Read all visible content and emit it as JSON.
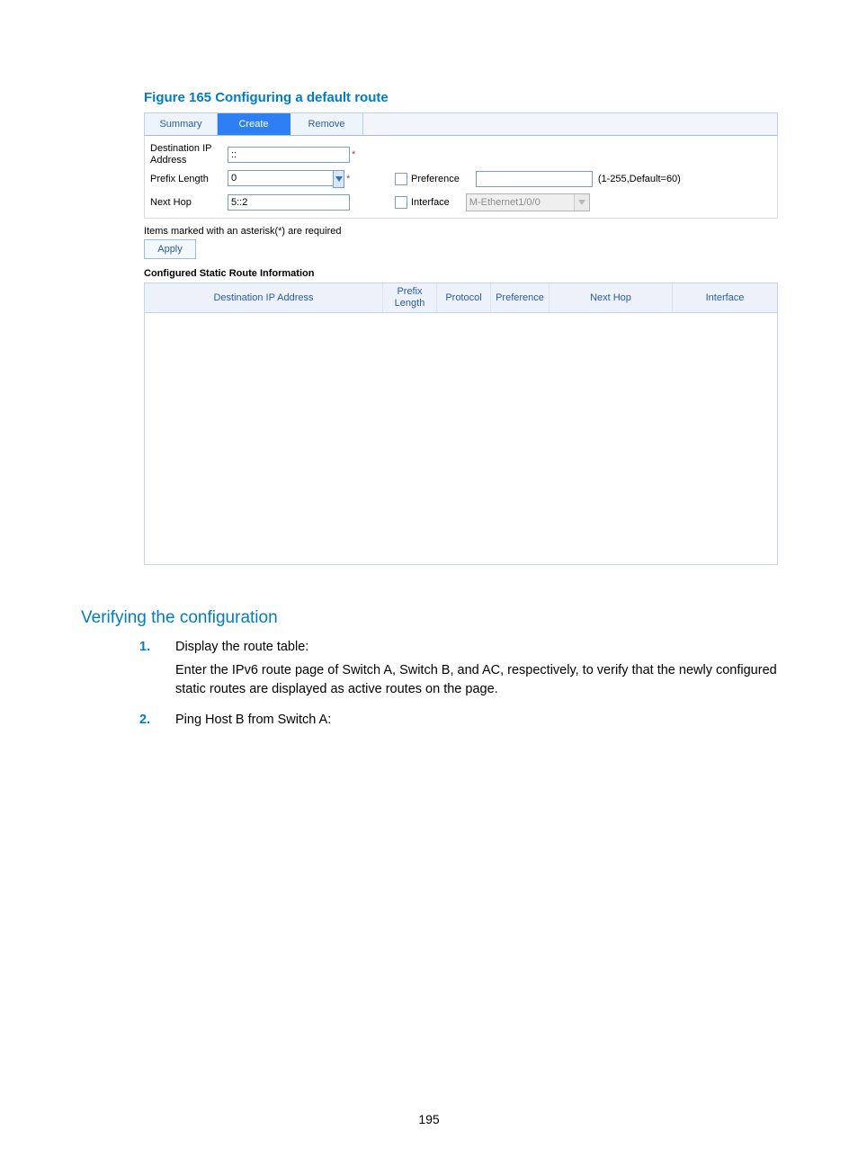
{
  "figure": {
    "label": "Figure 165",
    "title": "Configuring a default route"
  },
  "tabs": {
    "summary": "Summary",
    "create": "Create",
    "remove": "Remove"
  },
  "form": {
    "dest_label": "Destination IP Address",
    "dest_value": "::",
    "prefix_label": "Prefix Length",
    "prefix_value": "0",
    "nexthop_label": "Next Hop",
    "nexthop_value": "5::2",
    "pref_chk_label": "Preference",
    "pref_hint": "(1-255,Default=60)",
    "iface_chk_label": "Interface",
    "iface_value": "M-Ethernet1/0/0"
  },
  "required_note": "Items marked with an asterisk(*) are required",
  "apply_label": "Apply",
  "configured_heading": "Configured Static Route Information",
  "table_headers": {
    "dest": "Destination IP Address",
    "prefix": "Prefix Length",
    "protocol": "Protocol",
    "preference": "Preference",
    "nexthop": "Next Hop",
    "interface": "Interface"
  },
  "verify": {
    "heading": "Verifying the configuration",
    "steps": [
      {
        "n": "1.",
        "lead": "Display the route table:",
        "para": "Enter the IPv6 route page of Switch A, Switch B, and AC, respectively, to verify that the newly configured static routes are displayed as active routes on the page."
      },
      {
        "n": "2.",
        "lead": "Ping Host B from Switch A:",
        "para": ""
      }
    ]
  },
  "page_number": "195"
}
